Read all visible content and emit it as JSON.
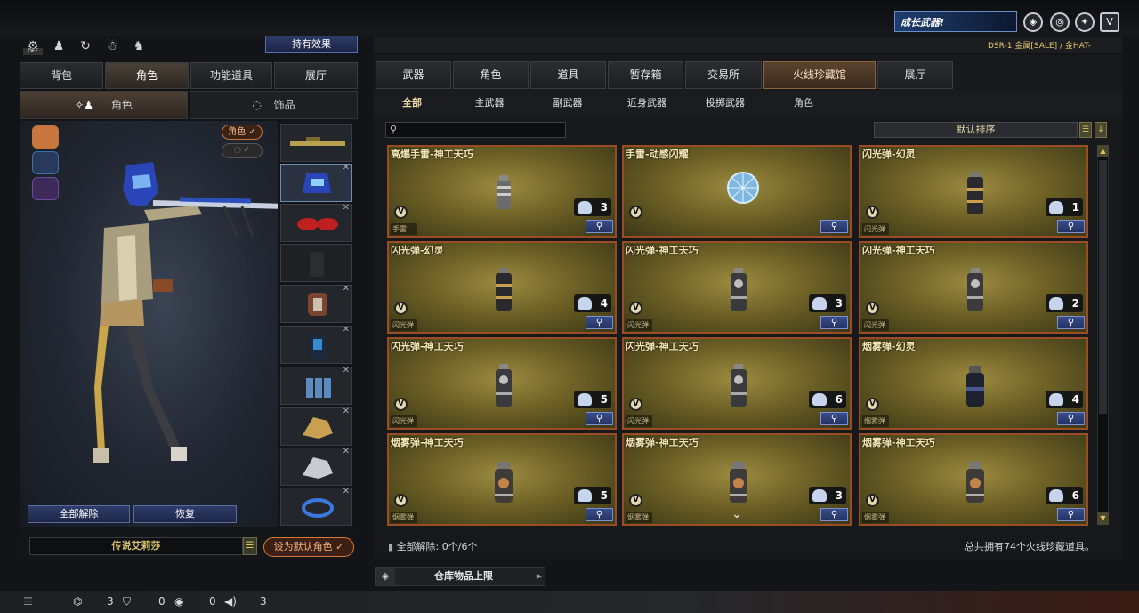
{
  "top": {
    "banner_text": "成长武器!",
    "ticker_text": "DSR-1 金属[SALE] / 金HAT-"
  },
  "left": {
    "off_label": "OFF",
    "effect_button": "持有效果",
    "tabs": [
      "背包",
      "角色",
      "功能道具",
      "展厅"
    ],
    "subtabs": [
      "角色",
      "饰品"
    ],
    "role_chip": "角色 ✓",
    "unequip_all": "全部解除",
    "restore": "恢复",
    "character_name": "传说艾莉莎",
    "set_default": "设为默认角色 ✓"
  },
  "right": {
    "tabs": [
      "武器",
      "角色",
      "道具",
      "暂存箱",
      "交易所",
      "火线珍藏馆",
      "展厅"
    ],
    "subtabs": [
      "全部",
      "主武器",
      "副武器",
      "近身武器",
      "投掷武器",
      "角色"
    ],
    "search_placeholder": "",
    "sort_label": "默认排序",
    "cards": [
      {
        "title": "高爆手雷-神工天巧",
        "type": "手雷",
        "count": "3",
        "item": "grenade"
      },
      {
        "title": "手雷-动感闪耀",
        "type": "",
        "count": "",
        "item": "disco"
      },
      {
        "title": "闪光弹-幻灵",
        "type": "闪光弹",
        "count": "1",
        "item": "flash-dark"
      },
      {
        "title": "闪光弹-幻灵",
        "type": "闪光弹",
        "count": "4",
        "item": "flash-dark"
      },
      {
        "title": "闪光弹-神工天巧",
        "type": "闪光弹",
        "count": "3",
        "item": "flash"
      },
      {
        "title": "闪光弹-神工天巧",
        "type": "闪光弹",
        "count": "2",
        "item": "flash"
      },
      {
        "title": "闪光弹-神工天巧",
        "type": "闪光弹",
        "count": "5",
        "item": "flash"
      },
      {
        "title": "闪光弹-神工天巧",
        "type": "闪光弹",
        "count": "6",
        "item": "flash"
      },
      {
        "title": "烟雾弹-幻灵",
        "type": "烟雾弹",
        "count": "4",
        "item": "smoke-dark"
      },
      {
        "title": "烟雾弹-神工天巧",
        "type": "烟雾弹",
        "count": "5",
        "item": "smoke"
      },
      {
        "title": "烟雾弹-神工天巧",
        "type": "烟雾弹",
        "count": "3",
        "item": "smoke"
      },
      {
        "title": "烟雾弹-神工天巧",
        "type": "烟雾弹",
        "count": "6",
        "item": "smoke"
      }
    ],
    "unequip_status": "全部解除: 0个/6个",
    "total_text": "总共拥有74个火线珍藏道具。",
    "warehouse_label": "仓库物品上限"
  },
  "status": {
    "count_a": "3",
    "count_b": "0",
    "count_c": "0",
    "count_d": "3"
  },
  "colors": {
    "card_border": "#9a4c22",
    "card_gold": "#9b8a40",
    "accent_orange": "#d97a3a",
    "button_blue": "#2e3c6a"
  }
}
